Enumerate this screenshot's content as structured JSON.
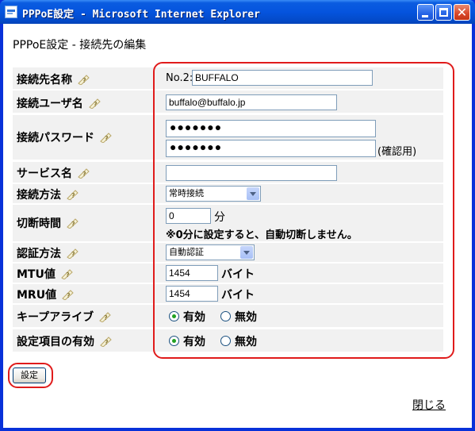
{
  "window": {
    "title": "PPPoE設定 - Microsoft Internet Explorer",
    "minimize_label": "",
    "maximize_label": "",
    "close_label": "✕"
  },
  "page": {
    "title": "PPPoE設定 - 接続先の編集",
    "set_button": "設定",
    "close_link": "閉じる"
  },
  "form": {
    "connection_name": {
      "label": "接続先名称",
      "prefix": "No.2:",
      "value": "BUFFALO"
    },
    "username": {
      "label": "接続ユーザ名",
      "value": "buffalo@buffalo.jp"
    },
    "password": {
      "label": "接続パスワード",
      "value": "●●●●●●●",
      "confirm_value": "●●●●●●●",
      "confirm_label": "(確認用)"
    },
    "service_name": {
      "label": "サービス名",
      "value": ""
    },
    "connection_method": {
      "label": "接続方法",
      "selected": "常時接続"
    },
    "disconnect_time": {
      "label": "切断時間",
      "value": "0",
      "unit": "分",
      "note": "※0分に設定すると、自動切断しません。"
    },
    "auth_method": {
      "label": "認証方法",
      "selected": "自動認証"
    },
    "mtu": {
      "label": "MTU値",
      "value": "1454",
      "unit": "バイト"
    },
    "mru": {
      "label": "MRU値",
      "value": "1454",
      "unit": "バイト"
    },
    "keepalive": {
      "label": "キープアライブ",
      "options": [
        "有効",
        "無効"
      ],
      "selected": "有効"
    },
    "setting_enabled": {
      "label": "設定項目の有効",
      "options": [
        "有効",
        "無効"
      ],
      "selected": "有効"
    }
  },
  "colors": {
    "title_bar": "#0554de",
    "highlight": "#e01b1b",
    "row_bg": "#f1f1f1"
  }
}
